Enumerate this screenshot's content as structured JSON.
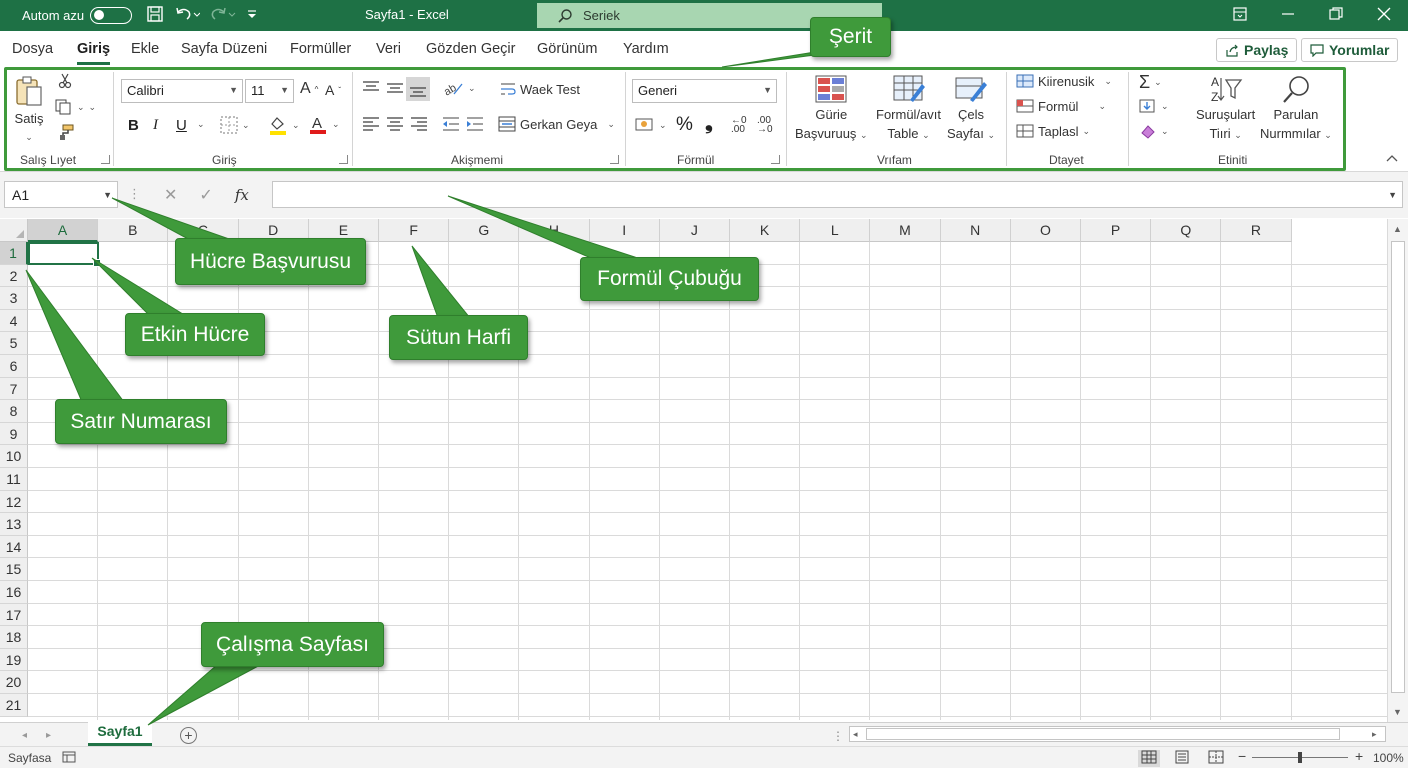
{
  "titlebar": {
    "autosave_label": "Autom azu",
    "title": "Sayfa1 - Excel",
    "search_placeholder": "Seriek"
  },
  "tabs": [
    "Dosya",
    "Giriş",
    "Ekle",
    "Sayfa Düzeni",
    "Formüller",
    "Veri",
    "Gözden Geçir",
    "Görünüm",
    "Yardım"
  ],
  "active_tab": "Giriş",
  "share_label": "Paylaş",
  "comments_label": "Yorumlar",
  "ribbon": {
    "clipboard": {
      "paste_label": "Satiş",
      "group_label": "Salış Lıyet"
    },
    "font": {
      "font_name": "Calibri",
      "font_size": "11",
      "group_label": "Giriş"
    },
    "alignment": {
      "wrap_label": "Waek Test",
      "merge_label": "Gerkan Geya",
      "group_label": "Akişmemi"
    },
    "number": {
      "format": "Generi",
      "group_label": "Förmül"
    },
    "styles": {
      "conditional_line1": "Gürie",
      "conditional_line2": "Başvuruuş",
      "format_table_line1": "Formül/avıt",
      "format_table_line2": "Table",
      "cell_styles_line1": "Çels",
      "cell_styles_line2": "Sayfaı",
      "group_label": "Vrıfam"
    },
    "cells": {
      "insert_label": "Kiirenusik",
      "delete_label": "Formül",
      "format_label": "Taplasl",
      "group_label": "Dtayet"
    },
    "editing": {
      "sort_line1": "Suruşulart",
      "sort_line2": "Tiıri",
      "find_line1": "Parulan",
      "find_line2": "Nurmmılar",
      "group_label": "Etiniti"
    }
  },
  "formula_bar": {
    "name_box": "A1",
    "formula": ""
  },
  "columns": [
    "A",
    "B",
    "C",
    "D",
    "E",
    "F",
    "G",
    "H",
    "I",
    "J",
    "K",
    "L",
    "M",
    "N",
    "O",
    "P",
    "Q",
    "R"
  ],
  "rows": [
    "1",
    "2",
    "3",
    "4",
    "5",
    "6",
    "7",
    "8",
    "9",
    "10",
    "11",
    "12",
    "13",
    "14",
    "15",
    "16",
    "17",
    "18",
    "19",
    "20",
    "21"
  ],
  "selected_cell": "A1",
  "sheet_tab": "Sayfa1",
  "status": {
    "ready_text": "Sayfasa",
    "zoom": "100%"
  },
  "callouts": {
    "ribbon": "Şerit",
    "name_box": "Hücre Başvurusu",
    "formula_bar": "Formül Çubuğu",
    "active_cell": "Etkin Hücre",
    "column_letter": "Sütun Harfi",
    "row_number": "Satır Numarası",
    "worksheet": "Çalışma Sayfası"
  },
  "colors": {
    "brand": "#1e7145",
    "callout": "#3f9a3b",
    "selection": "#217346"
  }
}
